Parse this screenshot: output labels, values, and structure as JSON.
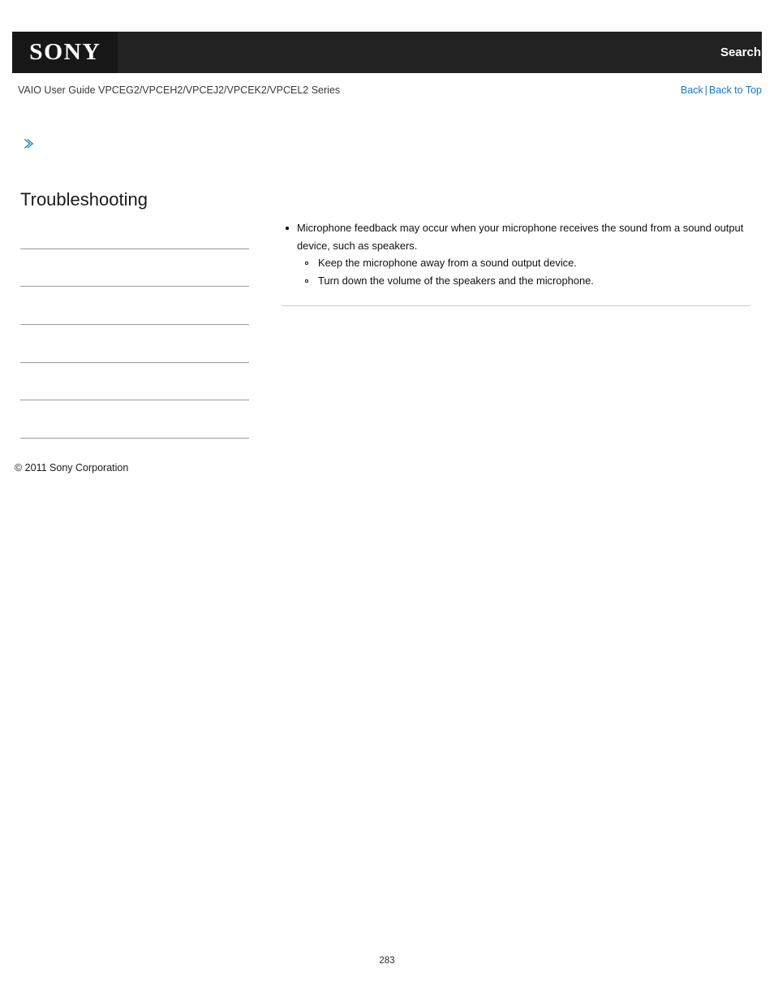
{
  "header": {
    "logo": "SONY",
    "search_label": "Search",
    "logo_bg": "#171717",
    "bar_bg": "#222222"
  },
  "subheader": {
    "guide_title": "VAIO User Guide VPCEG2/VPCEH2/VPCEJ2/VPCEK2/VPCEL2 Series",
    "back_label": "Back",
    "separator": "|",
    "back_to_top_label": "Back to Top",
    "link_color": "#1878c8"
  },
  "sidebar": {
    "arrow_icon": "chevron-right-icon",
    "arrow_color": "#2e8bc8",
    "title": "Troubleshooting",
    "items": [
      {
        "label": ""
      },
      {
        "label": ""
      },
      {
        "label": ""
      },
      {
        "label": ""
      },
      {
        "label": ""
      },
      {
        "label": ""
      }
    ],
    "copyright": "© 2011 Sony Corporation"
  },
  "main": {
    "bullets": [
      {
        "text": "Microphone feedback may occur when your microphone receives the sound from a sound output device, such as speakers.",
        "sub": [
          "Keep the microphone away from a sound output device.",
          "Turn down the volume of the speakers and the microphone."
        ]
      }
    ]
  },
  "footer": {
    "page_number": "283"
  }
}
